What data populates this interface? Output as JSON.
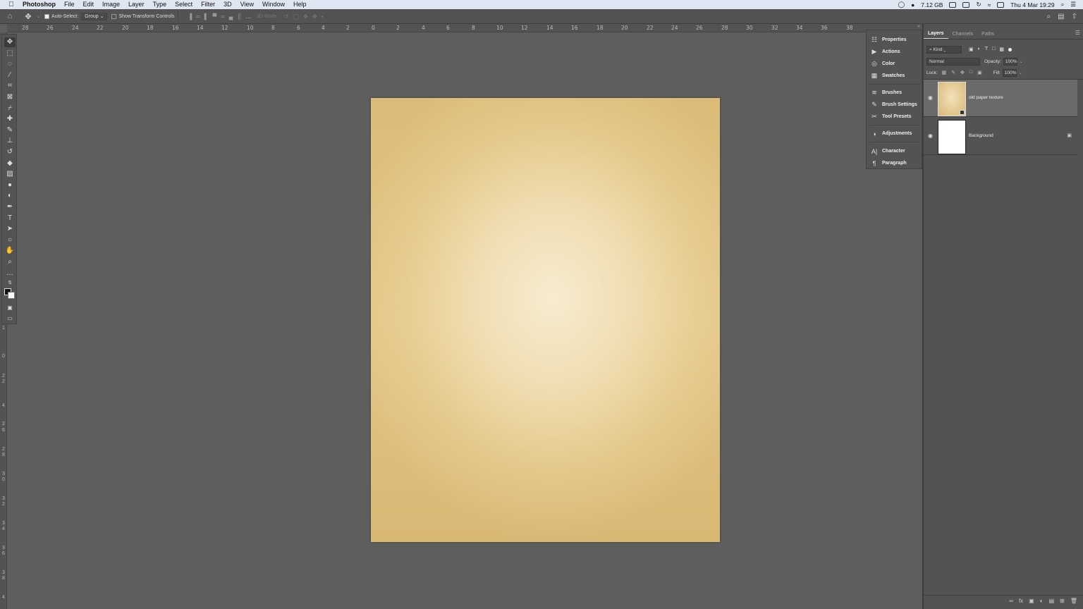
{
  "menubar": {
    "apple": "",
    "app_name": "Photoshop",
    "menus": [
      "File",
      "Edit",
      "Image",
      "Layer",
      "Type",
      "Select",
      "Filter",
      "3D",
      "View",
      "Window",
      "Help"
    ],
    "memory": "7.12 GB",
    "datetime": "Thu 4 Mar 19:29"
  },
  "options": {
    "auto_select_label": "Auto-Select:",
    "auto_select_value": "Group",
    "transform_controls_label": "Show Transform Controls",
    "mode_3d_label": "3D Mode:"
  },
  "ruler": {
    "labels": [
      "28",
      "26",
      "24",
      "22",
      "20",
      "18",
      "16",
      "14",
      "12",
      "10",
      "8",
      "6",
      "4",
      "2",
      "0",
      "2",
      "4",
      "6",
      "8",
      "10",
      "12",
      "14",
      "16",
      "18",
      "20",
      "22",
      "24",
      "26",
      "28",
      "30",
      "32",
      "34",
      "36",
      "38"
    ],
    "vertical_labels": [
      "1",
      "0",
      "2",
      "2",
      "4",
      "2",
      "6",
      "2",
      "8",
      "3",
      "0",
      "3",
      "2",
      "3",
      "4",
      "3",
      "6",
      "3",
      "8",
      "4"
    ]
  },
  "toolbar": {
    "tools": [
      {
        "name": "move-tool",
        "glyph": "✥"
      },
      {
        "name": "marquee-tool",
        "glyph": "⬚"
      },
      {
        "name": "lasso-tool",
        "glyph": "◌"
      },
      {
        "name": "magic-wand-tool",
        "glyph": "⁄"
      },
      {
        "name": "crop-tool",
        "glyph": "⌗"
      },
      {
        "name": "frame-tool",
        "glyph": "⊠"
      },
      {
        "name": "eyedropper-tool",
        "glyph": "⌿"
      },
      {
        "name": "healing-brush-tool",
        "glyph": "✚"
      },
      {
        "name": "brush-tool",
        "glyph": "✎"
      },
      {
        "name": "stamp-tool",
        "glyph": "⊥"
      },
      {
        "name": "history-brush-tool",
        "glyph": "↺"
      },
      {
        "name": "eraser-tool",
        "glyph": "◆"
      },
      {
        "name": "gradient-tool",
        "glyph": "▧"
      },
      {
        "name": "blur-tool",
        "glyph": "●"
      },
      {
        "name": "dodge-tool",
        "glyph": "◐"
      },
      {
        "name": "pen-tool",
        "glyph": "✒"
      },
      {
        "name": "type-tool",
        "glyph": "T"
      },
      {
        "name": "path-selection-tool",
        "glyph": "➤"
      },
      {
        "name": "ellipse-tool",
        "glyph": "○"
      },
      {
        "name": "hand-tool",
        "glyph": "✋"
      },
      {
        "name": "zoom-tool",
        "glyph": "⌕"
      },
      {
        "name": "more-tools",
        "glyph": "…"
      }
    ]
  },
  "dock": {
    "items": [
      {
        "label": "Properties",
        "icon": "properties-icon",
        "glyph": "☷"
      },
      {
        "label": "Actions",
        "icon": "actions-icon",
        "glyph": "▶"
      },
      {
        "label": "Color",
        "icon": "color-icon",
        "glyph": "◎"
      },
      {
        "label": "Swatches",
        "icon": "swatches-icon",
        "glyph": "▦"
      },
      {
        "label": "Brushes",
        "icon": "brushes-icon",
        "glyph": "≋"
      },
      {
        "label": "Brush Settings",
        "icon": "brush-settings-icon",
        "glyph": "✎"
      },
      {
        "label": "Tool Presets",
        "icon": "tool-presets-icon",
        "glyph": "✂"
      },
      {
        "label": "Adjustments",
        "icon": "adjustments-icon",
        "glyph": "◑"
      },
      {
        "label": "Character",
        "icon": "character-icon",
        "glyph": "A|"
      },
      {
        "label": "Paragraph",
        "icon": "paragraph-icon",
        "glyph": "¶"
      }
    ]
  },
  "layers_panel": {
    "tabs": [
      "Layers",
      "Channels",
      "Paths"
    ],
    "filter_kind": "Kind",
    "blend_mode": "Normal",
    "opacity_label": "Opacity:",
    "opacity_value": "100%",
    "lock_label": "Lock:",
    "fill_label": "Fill:",
    "fill_value": "100%",
    "layers": [
      {
        "name": "old paper texture",
        "selected": true
      },
      {
        "name": "Background",
        "locked": true
      }
    ]
  }
}
